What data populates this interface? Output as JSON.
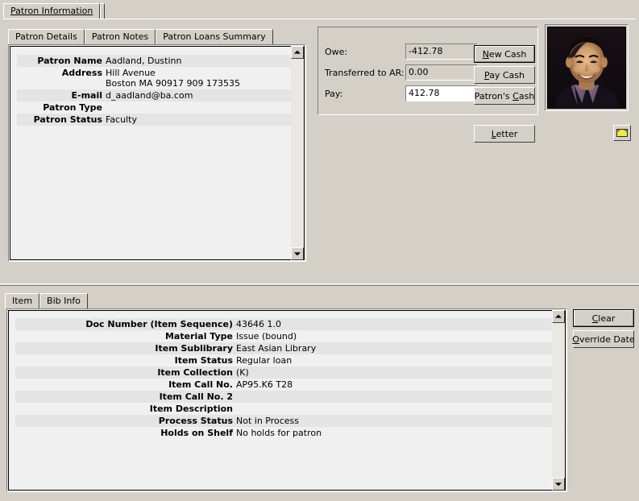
{
  "window": {
    "title": "Patron Information"
  },
  "outer_tabs": [
    {
      "label": "Patron Information",
      "active": true
    }
  ],
  "patron_tabs": [
    {
      "label": "Patron Details",
      "active": true
    },
    {
      "label": "Patron Notes",
      "active": false
    },
    {
      "label": "Patron Loans Summary",
      "active": false
    }
  ],
  "patron_details": {
    "rows": [
      {
        "label": "Patron Name",
        "value": "Aadland, Dustinn"
      },
      {
        "label": "Address",
        "value": "Hill Avenue\nBoston MA 90917 909 173535"
      },
      {
        "label": "E-mail",
        "value": "d_aadland@ba.com"
      },
      {
        "label": "Patron Type",
        "value": ""
      },
      {
        "label": "Patron Status",
        "value": "Faculty"
      }
    ]
  },
  "cash": {
    "owe_label": "Owe:",
    "owe_value": "-412.78",
    "transferred_label": "Transferred to AR:",
    "transferred_value": "0.00",
    "pay_label": "Pay:",
    "pay_value": "412.78",
    "buttons": {
      "new_cash": "New Cash",
      "new_cash_accel": "N",
      "pay_cash": "Pay Cash",
      "pay_cash_accel": "P",
      "patron_cash": "Patron's Cash",
      "patron_cash_accel": "C",
      "letter": "Letter",
      "letter_accel": "L"
    }
  },
  "photo": {
    "alt": "patron-photograph"
  },
  "mail_icon": {
    "name": "envelope-icon"
  },
  "item_tabs": [
    {
      "label": "Item",
      "active": true
    },
    {
      "label": "Bib Info",
      "active": false
    }
  ],
  "item_details": {
    "rows": [
      {
        "label": "Doc Number (Item Sequence)",
        "value": "43646 1.0"
      },
      {
        "label": "Material Type",
        "value": "Issue (bound)"
      },
      {
        "label": "Item Sublibrary",
        "value": "East Asian Library"
      },
      {
        "label": "Item Status",
        "value": "Regular loan"
      },
      {
        "label": "Item Collection",
        "value": "(K)"
      },
      {
        "label": "Item Call No.",
        "value": "AP95.K6 T28"
      },
      {
        "label": "Item Call No. 2",
        "value": ""
      },
      {
        "label": "Item Description",
        "value": ""
      },
      {
        "label": "Process Status",
        "value": "Not in Process"
      },
      {
        "label": "Holds on Shelf",
        "value": "No holds for patron"
      }
    ]
  },
  "item_buttons": {
    "clear": "Clear",
    "clear_accel": "C",
    "override_date": "Override Date",
    "override_accel": "O"
  },
  "colors": {
    "window_bg": "#d4d0c8",
    "list_bg": "#eff0ef",
    "row_shade": "#e4e4e4",
    "field_bg": "#ffffff",
    "readonly_field_bg": "#d4d0c8",
    "text": "#000000",
    "envelope": "#f2e84a"
  }
}
